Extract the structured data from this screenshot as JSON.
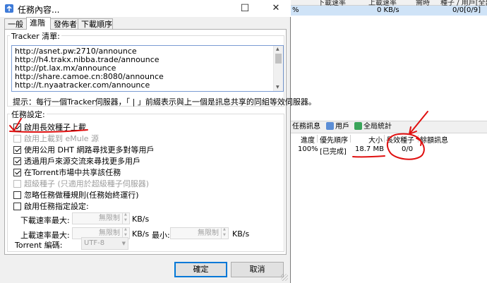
{
  "dialog": {
    "title": "任務內容...",
    "win_buttons": {
      "minimize": "—",
      "maximize": "☐",
      "close": "✕"
    },
    "tabs": [
      "一般",
      "進階",
      "發佈者",
      "下載順序"
    ],
    "active_tab": 1,
    "tracker": {
      "group_label": "Tracker 清單:",
      "urls": [
        "http://asnet.pw:2710/announce",
        "http://h4.trakx.nibba.trade/announce",
        "http://pt.lax.mx/announce",
        "http://share.camoe.cn:8080/announce",
        "http://t.nyaatracker.com/announce"
      ],
      "hint": "提示：每行一個Tracker伺服器，「 | 」前綴表示與上一個是訊息共享的同組等效伺服器。"
    },
    "task_settings": {
      "group_label": "任務設定:",
      "checkboxes": [
        {
          "label": "啟用長效種子上載",
          "checked": true,
          "enabled": true
        },
        {
          "label": "啟用上載到 eMule 源",
          "checked": false,
          "enabled": false
        },
        {
          "label": "使用公用 DHT 網路尋找更多對等用戶",
          "checked": true,
          "enabled": true
        },
        {
          "label": "透過用戶來源交流來尋找更多用戶",
          "checked": true,
          "enabled": true
        },
        {
          "label": "在Torrent市場中共享該任務",
          "checked": true,
          "enabled": true
        },
        {
          "label": "超級種子 (只適用於超級種子伺服器)",
          "checked": false,
          "enabled": false
        },
        {
          "label": "忽略任務做種規則(任務始終運行)",
          "checked": false,
          "enabled": true
        },
        {
          "label": "啟用任務指定設定:",
          "checked": false,
          "enabled": true
        }
      ],
      "download_rate": {
        "label": "下載速率",
        "max_label": "最大:",
        "max_value": "無限制",
        "unit": "KB/s"
      },
      "upload_rate": {
        "label": "上載速率",
        "max_label": "最大:",
        "max_value": "無限制",
        "unit": "KB/s",
        "min_label": "最小:",
        "min_value": "無限制",
        "min_unit": "KB/s"
      },
      "encoding": {
        "label": "Torrent 編碼:",
        "value": "UTF-8"
      }
    },
    "buttons": {
      "ok": "確定",
      "cancel": "取消"
    }
  },
  "background": {
    "header_cells": [
      "下載速率",
      "上載速率",
      "需時",
      "種子 / 用戶[全部]"
    ],
    "row": {
      "percent": "%",
      "upload_speed": "0 KB/s",
      "peers": "0/0[0/9]"
    },
    "detail_tabs": [
      "任務訊息",
      "用戶",
      "全局統計"
    ],
    "columns": [
      "進度",
      "優先順序",
      "大小",
      "長效種子",
      "餘額訊息"
    ],
    "data_row": {
      "progress": "100%",
      "priority": "[已完成]",
      "size": "18.7 MB",
      "seeds": "0/0"
    }
  },
  "colors": {
    "annotation": "#e01010",
    "selection": "#cfe3f7",
    "accent": "#0078d7"
  }
}
